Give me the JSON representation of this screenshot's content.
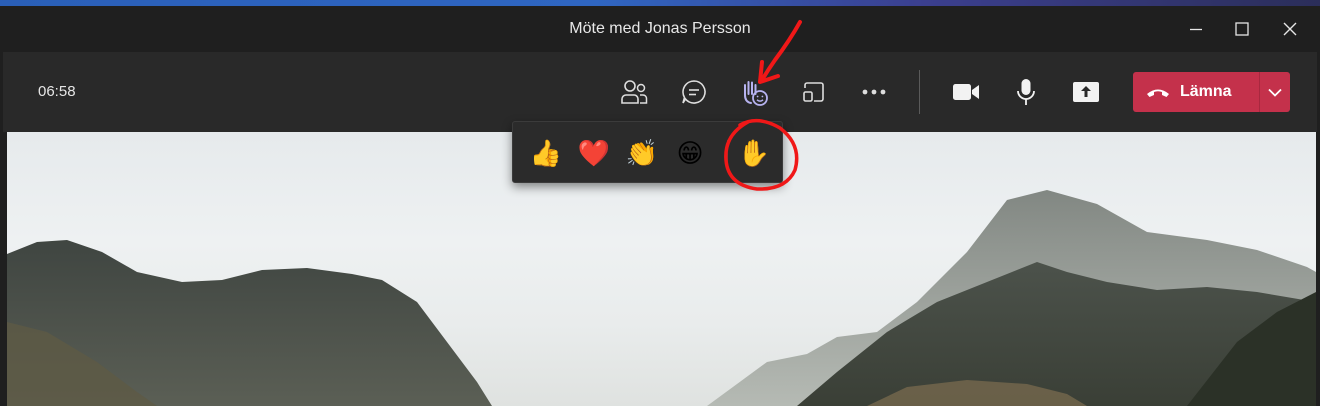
{
  "window": {
    "title": "Möte med Jonas Persson"
  },
  "toolbar": {
    "timer": "06:58",
    "icons": [
      "people-icon",
      "chat-icon",
      "raise-hand-reactions-icon",
      "share-tray-icon",
      "more-icon",
      "camera-icon",
      "microphone-icon",
      "share-screen-icon"
    ],
    "leave_label": "Lämna"
  },
  "reactions": {
    "items": [
      {
        "name": "like",
        "glyph": "👍"
      },
      {
        "name": "heart",
        "glyph": "❤️"
      },
      {
        "name": "applause",
        "glyph": "👏"
      },
      {
        "name": "laugh",
        "glyph": "😁"
      },
      {
        "name": "raise-hand",
        "glyph": "✋"
      }
    ]
  },
  "colors": {
    "leave_button": "#c4314b",
    "toolbar_bg": "#292929",
    "annotation": "#ff0000"
  }
}
